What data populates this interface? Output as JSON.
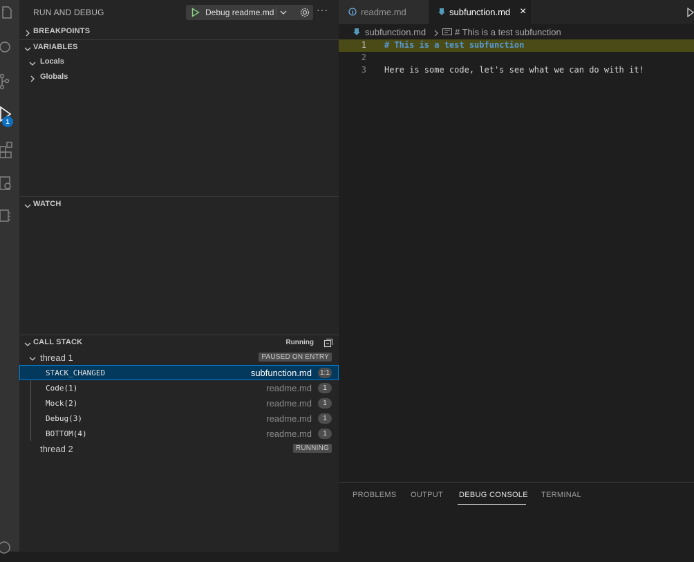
{
  "sidebar": {
    "title": "RUN AND DEBUG",
    "launch_config": "Debug readme.md",
    "more_label": "···",
    "sections": {
      "breakpoints": "BREAKPOINTS",
      "variables": "VARIABLES",
      "watch": "WATCH",
      "call_stack": "CALL STACK"
    },
    "variables": {
      "locals": "Locals",
      "globals": "Globals"
    },
    "call_stack": {
      "status": "Running",
      "threads": [
        {
          "name": "thread 1",
          "state": "PAUSED ON ENTRY",
          "frames": [
            {
              "name": "STACK_CHANGED",
              "file": "subfunction.md",
              "line": "1:1"
            },
            {
              "name": "Code(1)",
              "file": "readme.md",
              "line": "1"
            },
            {
              "name": "Mock(2)",
              "file": "readme.md",
              "line": "1"
            },
            {
              "name": "Debug(3)",
              "file": "readme.md",
              "line": "1"
            },
            {
              "name": "BOTTOM(4)",
              "file": "readme.md",
              "line": "1"
            }
          ]
        },
        {
          "name": "thread 2",
          "state": "RUNNING"
        }
      ]
    }
  },
  "activity_bar": {
    "badge": "1"
  },
  "editor": {
    "tabs": [
      {
        "label": "readme.md",
        "icon": "info-icon",
        "active": false
      },
      {
        "label": "subfunction.md",
        "icon": "markdown-icon",
        "active": true,
        "close": "×"
      }
    ],
    "breadcrumb": {
      "file": "subfunction.md",
      "symbol": "# This is a test subfunction"
    },
    "lines": [
      {
        "n": "1",
        "text": "# This is a test subfunction"
      },
      {
        "n": "2",
        "text": ""
      },
      {
        "n": "3",
        "text": "Here is some code, let's see what we can do with it!"
      }
    ]
  },
  "panel": {
    "tabs": [
      "PROBLEMS",
      "OUTPUT",
      "DEBUG CONSOLE",
      "TERMINAL"
    ],
    "active": "DEBUG CONSOLE"
  },
  "colors": {
    "accent": "#007fd4",
    "selection": "#04395e",
    "debug_line_highlight": "#4b4b18",
    "heading_blue": "#569cd6",
    "play_green": "#89d185",
    "pointer_yellow": "#ffcc00"
  }
}
